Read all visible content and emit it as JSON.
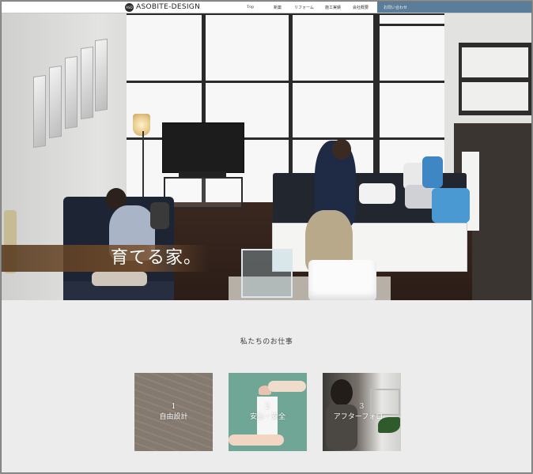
{
  "header": {
    "logo_text": "ASOBITE-DESIGN",
    "logo_mark": "ASO",
    "nav": [
      "Top",
      "新築",
      "リフォーム",
      "施工実績",
      "会社概要"
    ],
    "contact": "お問い合わせ"
  },
  "hero": {
    "tagline": "育てる家。"
  },
  "section": {
    "title": "私たちのお仕事",
    "cards": [
      {
        "number": "1",
        "label": "自由設計"
      },
      {
        "number": "2",
        "label": "安心・安全"
      },
      {
        "number": "3",
        "label": "アフターフォロー"
      }
    ]
  },
  "colors": {
    "header_bg": "#ffffff",
    "contact_bg": "#5a7e9a",
    "page_bg": "#ececec",
    "tagline_band": "#6b4a2c",
    "card2_bg": "#6fa695"
  }
}
